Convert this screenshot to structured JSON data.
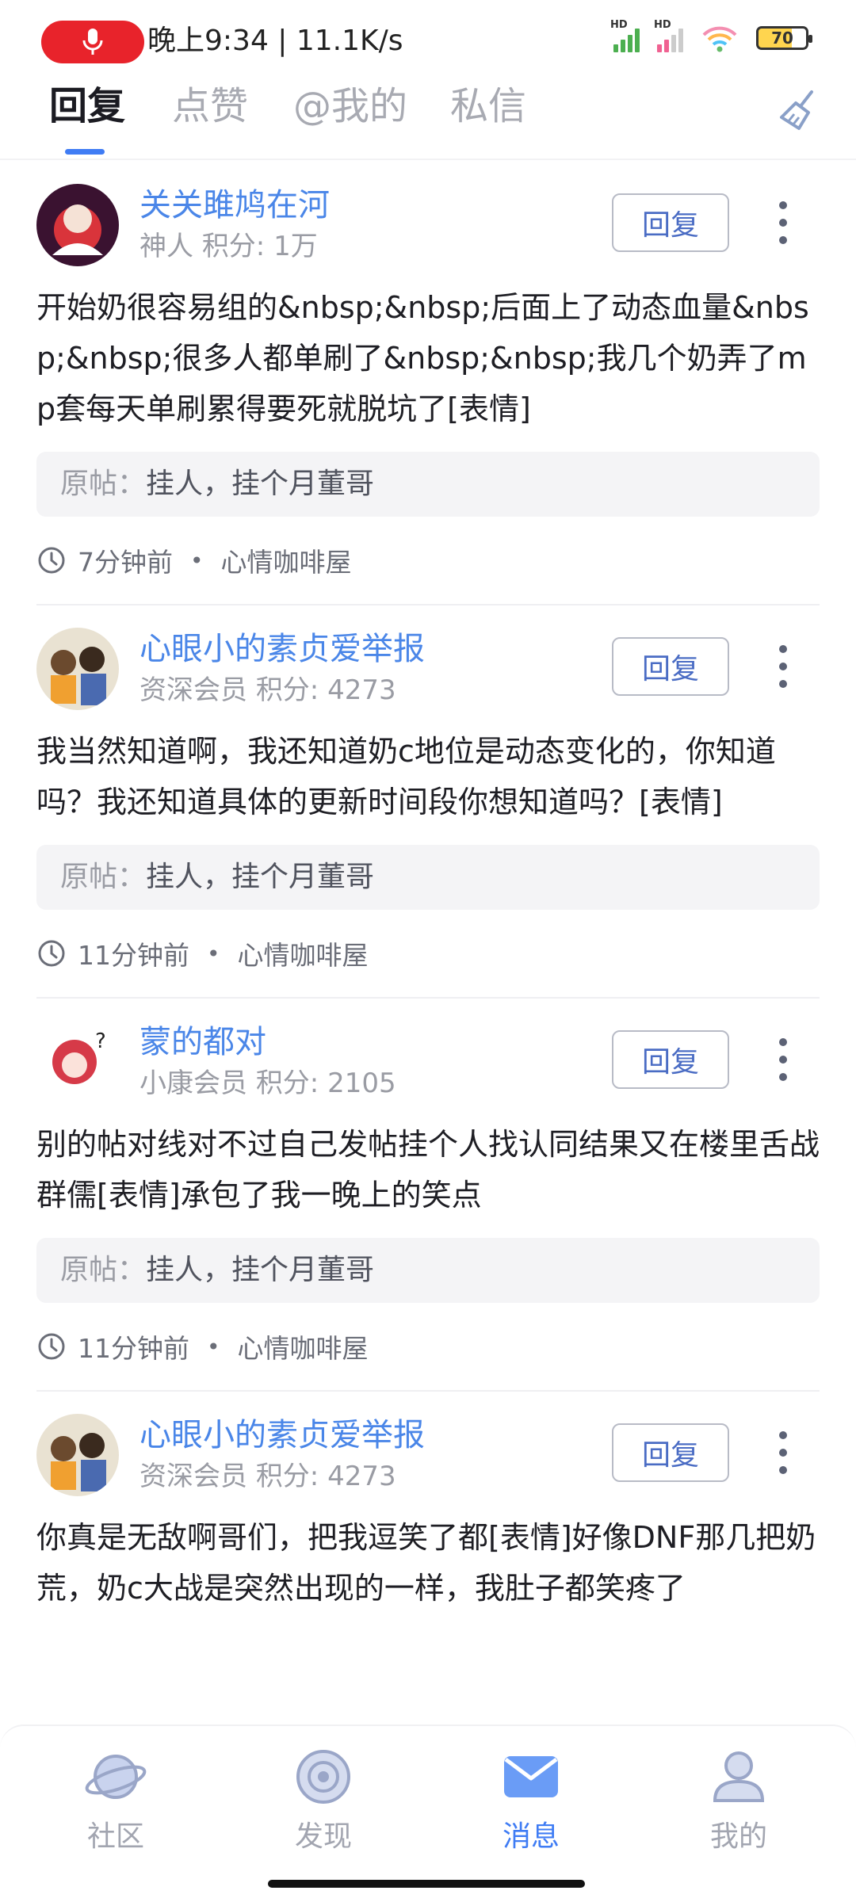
{
  "status_bar": {
    "time_speed": "晚上9:34 | 11.1K/s",
    "battery": "70",
    "hd1": "HD",
    "hd2": "HD"
  },
  "tabs": [
    {
      "label": "回复",
      "active": true
    },
    {
      "label": "点赞",
      "active": false
    },
    {
      "label": "@我的",
      "active": false
    },
    {
      "label": "私信",
      "active": false
    }
  ],
  "reply_label": "回复",
  "origin_prefix": "原帖：",
  "items": [
    {
      "username": "关关雎鸠在河",
      "level": "神人",
      "points": "积分: 1万",
      "content": "开始奶很容易组的&nbsp;&nbsp;后面上了动态血量&nbsp;&nbsp;很多人都单刷了&nbsp;&nbsp;我几个奶弄了mp套每天单刷累得要死就脱坑了[表情]",
      "origin": "挂人，挂个月董哥",
      "time": "7分钟前",
      "board": "心情咖啡屋"
    },
    {
      "username": "心眼小的素贞爱举报",
      "level": "资深会员",
      "points": "积分: 4273",
      "content": "我当然知道啊，我还知道奶c地位是动态变化的，你知道吗？我还知道具体的更新时间段你想知道吗？[表情]",
      "origin": "挂人，挂个月董哥",
      "time": "11分钟前",
      "board": "心情咖啡屋"
    },
    {
      "username": "蒙的都对",
      "level": "小康会员",
      "points": "积分: 2105",
      "content": "别的帖对线对不过自己发帖挂个人找认同结果又在楼里舌战群儒[表情]承包了我一晚上的笑点",
      "origin": "挂人，挂个月董哥",
      "time": "11分钟前",
      "board": "心情咖啡屋"
    },
    {
      "username": "心眼小的素贞爱举报",
      "level": "资深会员",
      "points": "积分: 4273",
      "content": "你真是无敌啊哥们，把我逗笑了都[表情]好像DNF那几把奶荒，奶c大战是突然出现的一样，我肚子都笑疼了",
      "origin": "",
      "time": "",
      "board": ""
    }
  ],
  "bottom_nav": [
    {
      "label": "社区",
      "icon": "planet-icon",
      "active": false
    },
    {
      "label": "发现",
      "icon": "discover-icon",
      "active": false
    },
    {
      "label": "消息",
      "icon": "mail-icon",
      "active": true
    },
    {
      "label": "我的",
      "icon": "profile-icon",
      "active": false
    }
  ],
  "colors": {
    "accent": "#3f7cf4",
    "username": "#4a86e8",
    "mic": "#e8232b"
  }
}
